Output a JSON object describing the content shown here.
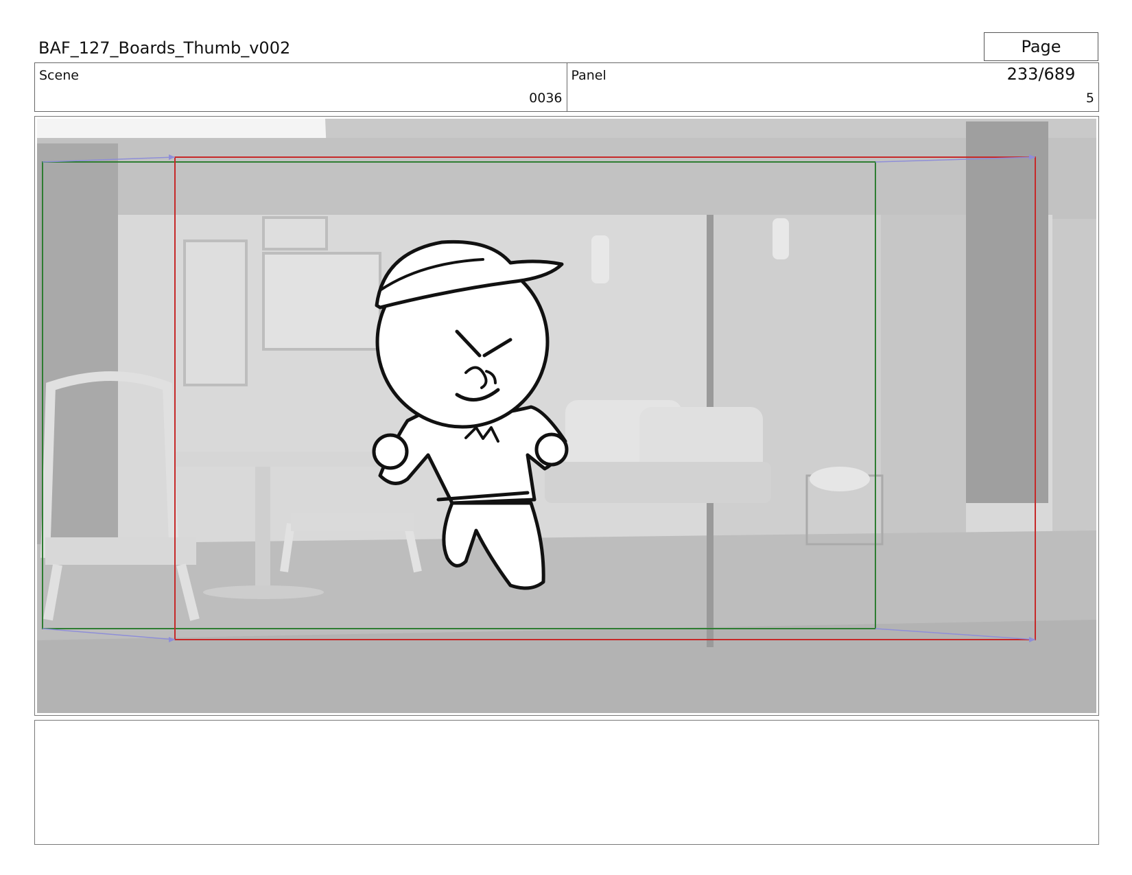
{
  "header": {
    "title": "BAF_127_Boards_Thumb_v002",
    "page": "Page 233/689"
  },
  "info": {
    "scene_label": "Scene",
    "scene_value": "0036",
    "panel_label": "Panel",
    "panel_value": "5"
  },
  "colors": {
    "safe_frame": "#2e7d32",
    "camera_frame": "#c62828",
    "motion_arrow": "#8e8ed8"
  },
  "notes": ""
}
